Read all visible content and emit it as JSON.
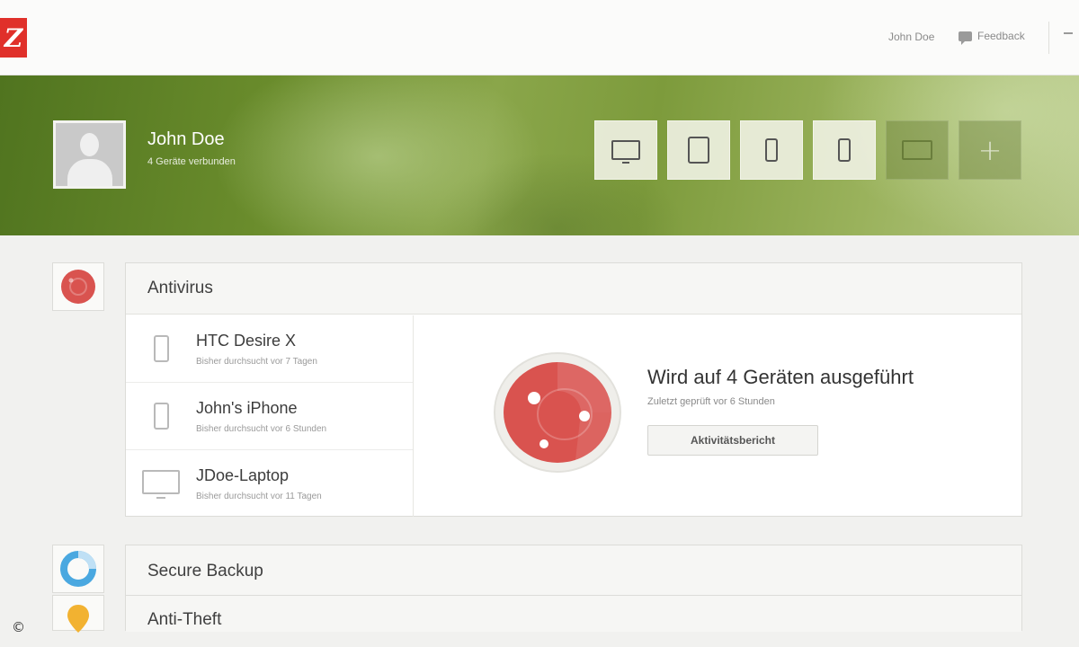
{
  "header": {
    "logo_text": "Z",
    "user_name": "John Doe",
    "feedback_label": "Feedback"
  },
  "profile": {
    "name": "John Doe",
    "subtitle": "4 Geräte verbunden"
  },
  "device_tiles": [
    {
      "icon": "monitor-icon",
      "active": true
    },
    {
      "icon": "tablet-icon",
      "active": true
    },
    {
      "icon": "phone-icon",
      "active": true
    },
    {
      "icon": "phone-icon",
      "active": true
    },
    {
      "icon": "laptop-icon",
      "active": false
    },
    {
      "icon": "plus-icon",
      "label": "+",
      "active": false
    }
  ],
  "antivirus": {
    "title": "Antivirus",
    "devices": [
      {
        "name": "HTC Desire X",
        "status": "Bisher durchsucht vor 7 Tagen",
        "icon": "phone-icon"
      },
      {
        "name": "John's iPhone",
        "status": "Bisher durchsucht vor 6 Stunden",
        "icon": "phone-icon"
      },
      {
        "name": "JDoe-Laptop",
        "status": "Bisher durchsucht vor 11 Tagen",
        "icon": "laptop-icon"
      }
    ],
    "status_title": "Wird auf 4 Geräten ausgeführt",
    "status_sub": "Zuletzt geprüft vor 6 Stunden",
    "report_button": "Aktivitätsbericht",
    "color": "#d9534f"
  },
  "secure_backup": {
    "title": "Secure Backup",
    "color": "#4aa8e0"
  },
  "anti_theft": {
    "title": "Anti-Theft",
    "color": "#f2b231"
  },
  "footer": {
    "copyright": "©"
  }
}
